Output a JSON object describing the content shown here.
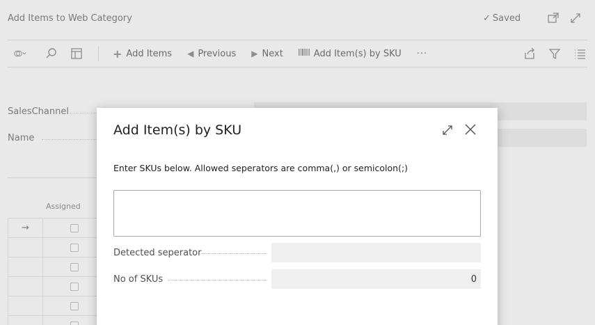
{
  "page": {
    "title": "Add Items to Web Category",
    "saved_label": "Saved"
  },
  "toolbar": {
    "add_items": "Add Items",
    "previous": "Previous",
    "next": "Next",
    "add_by_sku": "Add Item(s) by SKU",
    "more": "···"
  },
  "fields": {
    "sales_channel_label": "SalesChannel",
    "name_label": "Name"
  },
  "grid": {
    "assigned_header": "Assigned",
    "rows": [
      "→",
      "",
      "",
      "",
      "",
      ""
    ]
  },
  "dialog": {
    "title": "Add Item(s) by SKU",
    "instructions": "Enter SKUs below. Allowed seperators are comma(,) or semicolon(;)",
    "sku_input_value": "",
    "detected_separator_label": "Detected seperator",
    "detected_separator_value": "",
    "no_of_skus_label": "No of SKUs",
    "no_of_skus_value": "0"
  }
}
